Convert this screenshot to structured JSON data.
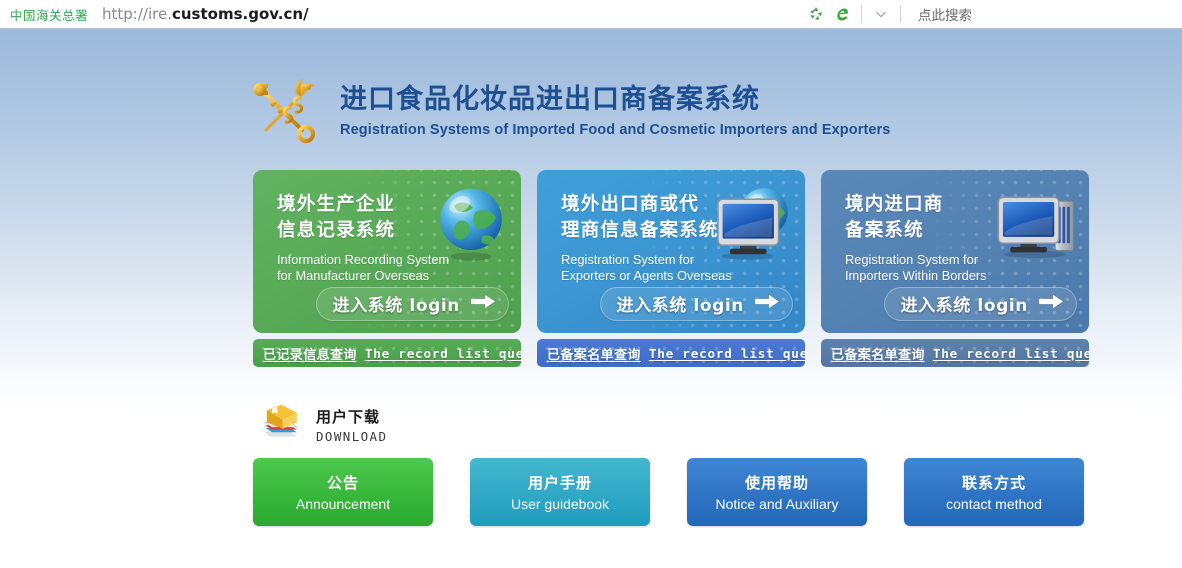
{
  "browser": {
    "brand_label": "中国海关总署",
    "url_prefix": "http://ire.",
    "url_domain": "customs.gov.cn/",
    "icons": {
      "sync": "sync-green-icon",
      "browser_e": "ie-browser-icon",
      "chevron": "chevron-down-icon"
    },
    "search_placeholder": "点此搜索"
  },
  "header": {
    "logo": "customs-key-caduceus-emblem-icon",
    "title_cn": "进口食品化妆品进出口商备案系统",
    "title_en": "Registration Systems of Imported Food and Cosmetic Importers and Exporters"
  },
  "cards": [
    {
      "theme": "green",
      "title_cn_line1": "境外生产企业",
      "title_cn_line2": "信息记录系统",
      "sub_line1": "Information Recording System",
      "sub_line2": "for Manufacturer Overseas",
      "login_label": "进入系统  login",
      "art": "globe-icon",
      "query_cn": "已记录信息查询",
      "query_en": "The record list query"
    },
    {
      "theme": "blue",
      "title_cn_line1": "境外出口商或代",
      "title_cn_line2": "理商信息备案系统",
      "sub_line1": "Registration System for",
      "sub_line2": "Exporters or Agents Overseas",
      "login_label": "进入系统  login",
      "art": "monitor-globe-icon",
      "query_cn": "已备案名单查询",
      "query_en": "The record list query"
    },
    {
      "theme": "steel",
      "title_cn_line1": "境内进口商",
      "title_cn_line2": "备案系统",
      "sub_line1": "Registration System for",
      "sub_line2": "Importers Within Borders",
      "login_label": "进入系统  login",
      "art": "desktop-computer-icon",
      "query_cn": "已备案名单查询",
      "query_en": "The record list query"
    }
  ],
  "download": {
    "icon": "books-stack-icon",
    "label_cn": "用户下载",
    "label_en": "DOWNLOAD"
  },
  "nav_buttons": [
    {
      "cn": "公告",
      "en": "Announcement",
      "theme": "green"
    },
    {
      "cn": "用户手册",
      "en": "User guidebook",
      "theme": "teal"
    },
    {
      "cn": "使用帮助",
      "en": "Notice and Auxiliary",
      "theme": "blue"
    },
    {
      "cn": "联系方式",
      "en": "contact method",
      "theme": "blue"
    }
  ],
  "colors": {
    "brand_green": "#2fa84f",
    "title_blue": "#1d4f91",
    "card_green": "#59ab58",
    "card_blue": "#3c96d2",
    "card_steel": "#5483b4",
    "page_top": "#9cb9dc"
  }
}
